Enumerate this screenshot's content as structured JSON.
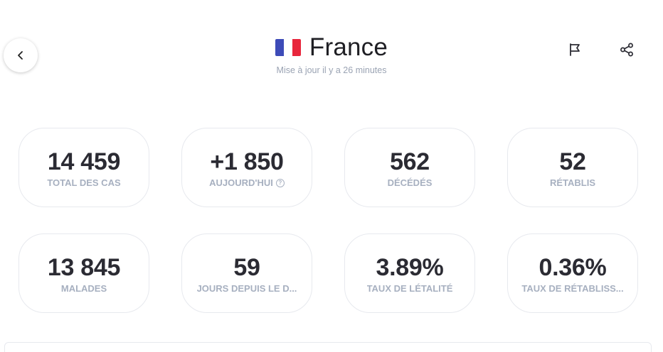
{
  "header": {
    "country": "France",
    "updated": "Mise à jour il y a 26 minutes",
    "flag_colors": [
      "#3d4bb8",
      "#ffffff",
      "#e8263c"
    ]
  },
  "icons": {
    "back": "chevron-left-icon",
    "flag": "flag-icon",
    "share": "share-icon",
    "help": "help-circle-icon"
  },
  "stats": [
    {
      "value": "14 459",
      "label": "TOTAL DES CAS"
    },
    {
      "value": "+1 850",
      "label": "AUJOURD'HUI"
    },
    {
      "value": "562",
      "label": "DÉCÉDÉS"
    },
    {
      "value": "52",
      "label": "RÉTABLIS"
    },
    {
      "value": "13 845",
      "label": "MALADES"
    },
    {
      "value": "59",
      "label": "JOURS DEPUIS LE D..."
    },
    {
      "value": "3.89%",
      "label": "TAUX DE LÉTALITÉ"
    },
    {
      "value": "0.36%",
      "label": "TAUX DE RÉTABLISS..."
    }
  ]
}
